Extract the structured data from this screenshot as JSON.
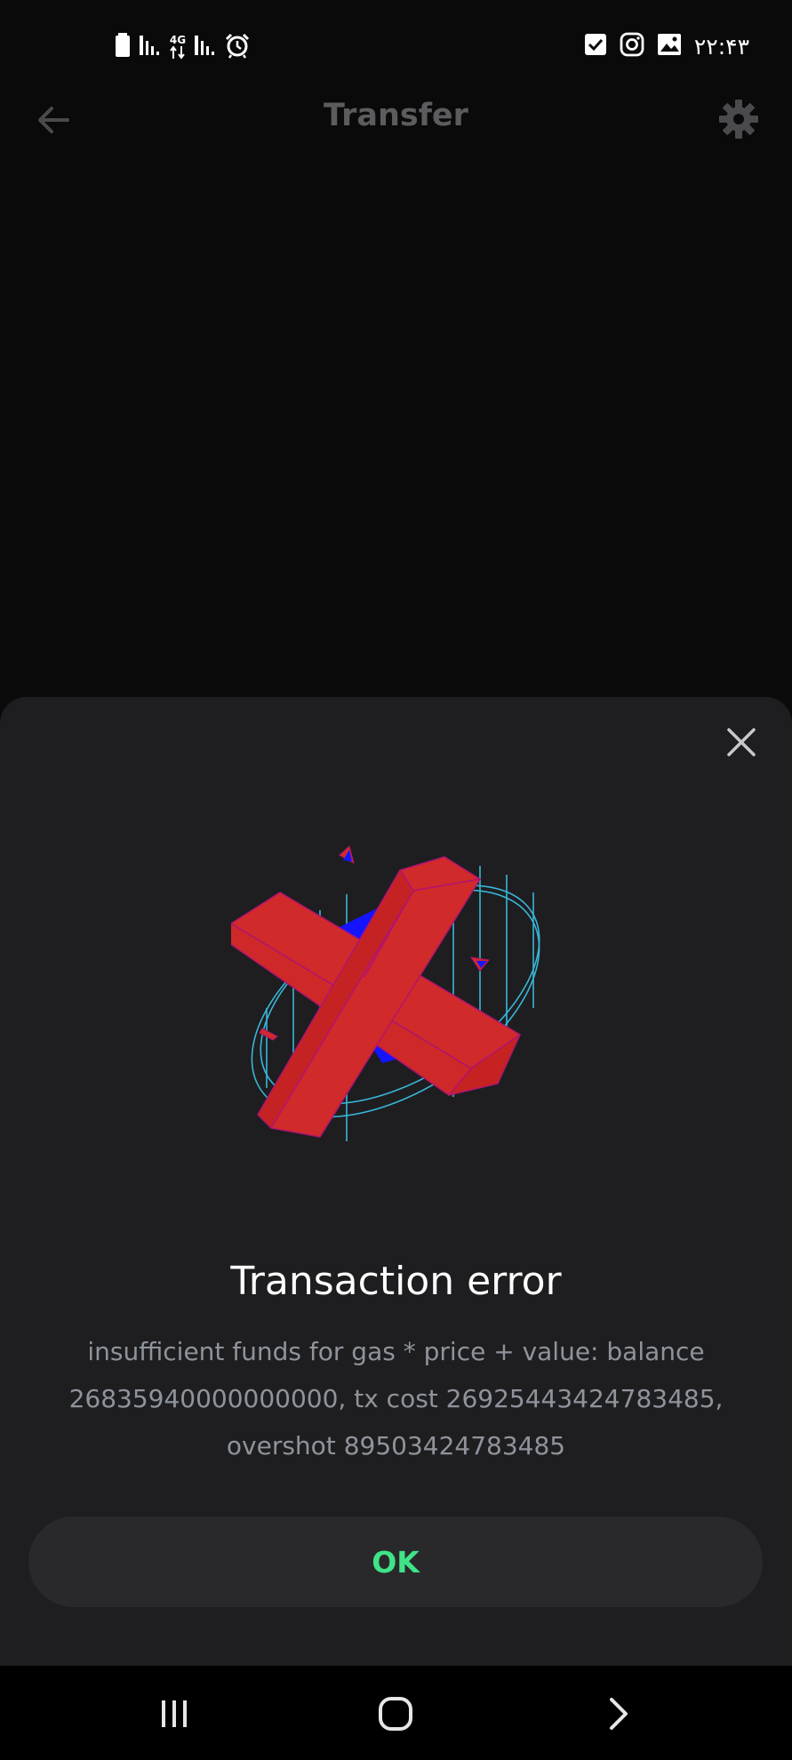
{
  "status_bar": {
    "time": "۲۲:۴۳",
    "network_label": "4G",
    "left_icons": [
      "battery-icon",
      "signal-icon",
      "data-arrows-icon",
      "signal-icon",
      "alarm-icon"
    ],
    "right_icons": [
      "check-notification-icon",
      "instagram-icon",
      "gallery-icon"
    ]
  },
  "header": {
    "title": "Transfer",
    "back_icon": "arrow-left-icon",
    "settings_icon": "gear-icon"
  },
  "dialog": {
    "close_icon": "close-icon",
    "illustration": "error-cross-illustration",
    "title": "Transaction error",
    "message": "insufficient funds for gas * price + value: balance 26835940000000000, tx cost 26925443424783485, overshot 89503424783485",
    "ok_label": "OK"
  },
  "nav_bar": {
    "icons": [
      "recent-apps-icon",
      "home-icon",
      "back-chevron-icon"
    ]
  },
  "colors": {
    "background": "#0a0a0b",
    "sheet": "#1e1e20",
    "button": "#29292c",
    "accent_green": "#3fe388",
    "header_muted": "#5c5c5f",
    "message_grey": "#8f939b",
    "cross_red": "#d12a2a",
    "cross_blue": "#1414ff",
    "ring_cyan": "#38b6d8"
  }
}
